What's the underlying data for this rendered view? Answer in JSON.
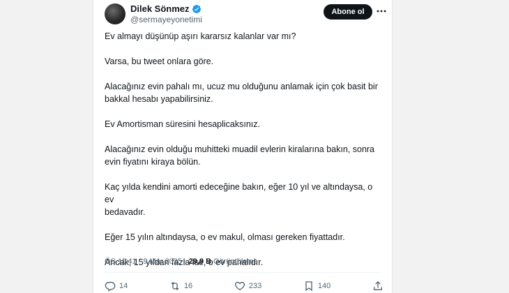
{
  "tweet": {
    "author_name": "Dilek Sönmez",
    "author_handle": "@sermayeyonetimi",
    "follow_label": "Abone ol",
    "paragraphs": [
      "Ev almayı düşünüp aşırı kararsız kalanlar var mı?",
      "Varsa, bu tweet onlara göre.",
      "Alacağınız evin pahalı mı, ucuz mu olduğunu anlamak için çok basit bir\nbakkal hesabı yapabilirsiniz.",
      "Ev Amortisman süresini hesaplicaksınız.",
      "Alacağınız evin olduğu muhitteki muadil evlerin kiralarına bakın, sonra\nevin fiyatını kiraya bölün.",
      "Kaç yılda kendini amorti edeceğine bakın, eğer 10 yıl ve altındaysa, o ev\nbedavadır.",
      "Eğer 15 yılın altındaysa, o ev makul, olması gereken fiyattadır.",
      "Ancak, 15 yıldan fazla ise, o ev pahalıdır."
    ],
    "time": "ÖS 11:41",
    "sep": "·",
    "date": "9 Mar 2025",
    "views_count": "29,9 B",
    "views_label": "Görüntüleme",
    "replies": "14",
    "retweets": "16",
    "likes": "233",
    "bookmarks": "140"
  },
  "icons": [
    "verified-badge-icon",
    "more-icon",
    "reply-icon",
    "retweet-icon",
    "like-icon",
    "bookmark-icon",
    "share-icon"
  ],
  "colors": {
    "accent": "#1d9bf0",
    "text": "#0f1419",
    "muted": "#536471",
    "button": "#0f1419"
  }
}
